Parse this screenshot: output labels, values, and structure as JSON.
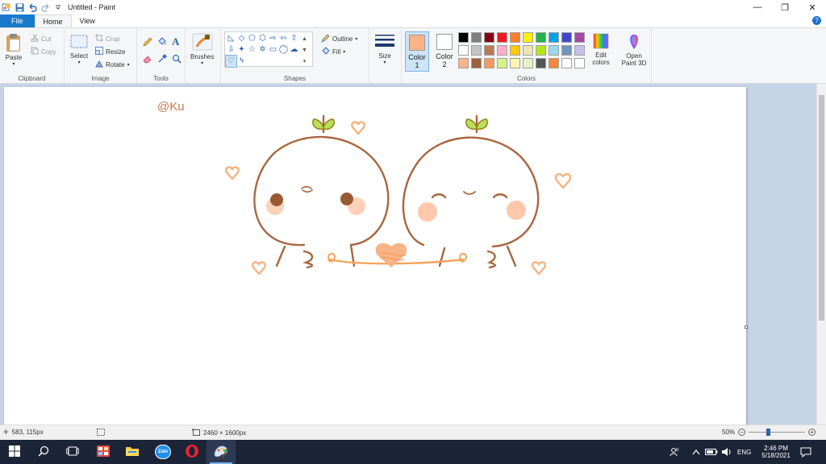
{
  "window": {
    "title": "Untitled - Paint",
    "controls": {
      "minimize": "—",
      "restore": "❐",
      "close": "✕"
    }
  },
  "ribbon_tabs": [
    {
      "label": "File"
    },
    {
      "label": "Home"
    },
    {
      "label": "View"
    }
  ],
  "help_label": "?",
  "clipboard": {
    "label": "Clipboard",
    "paste": "Paste",
    "cut": "Cut",
    "copy": "Copy"
  },
  "image": {
    "label": "Image",
    "select": "Select",
    "crop": "Crop",
    "resize": "Resize",
    "rotate": "Rotate"
  },
  "tools": {
    "label": "Tools",
    "text_tool": "A"
  },
  "brushes": {
    "label": "Brushes"
  },
  "shapes": {
    "label": "Shapes",
    "outline": "Outline",
    "fill": "Fill"
  },
  "size": {
    "label": "Size"
  },
  "colors": {
    "label": "Colors",
    "color1": {
      "label": "Color",
      "number": "1",
      "value": "#fbb387"
    },
    "color2": {
      "label": "Color",
      "number": "2",
      "value": "#ffffff"
    },
    "edit": "Edit colors",
    "open_paint3d": "Open Paint 3D",
    "palette_row1": [
      "#000000",
      "#7f7f7f",
      "#880015",
      "#ed1c24",
      "#ff7f27",
      "#fff200",
      "#22b14c",
      "#00a2e8",
      "#3f48cc",
      "#a349a4"
    ],
    "palette_row2": [
      "#ffffff",
      "#c3c3c3",
      "#b97a57",
      "#ffaec9",
      "#ffc90e",
      "#efe4b0",
      "#b5e61d",
      "#99d9ea",
      "#7092be",
      "#c8bfe7"
    ],
    "palette_row3": [
      "#fbb387",
      "#a0603c",
      "#f39a62",
      "#d6f08a",
      "#fff6b0",
      "#e8f0c6",
      "#555555",
      "#f4873d",
      "#ffffff",
      "#ffffff"
    ]
  },
  "canvas": {
    "signature": "@Ku"
  },
  "status": {
    "cursor_pos": "583, 115px",
    "image_size": "2460 × 1600px",
    "zoom": "50%",
    "zoom_level": 0.5
  },
  "taskbar": {
    "language": "ENG",
    "time": "2:46 PM",
    "date": "5/18/2021",
    "apps": [
      "windows-start",
      "search",
      "task-view",
      "photos",
      "file-explorer",
      "zalo",
      "opera",
      "paint"
    ],
    "zalo_label": "Zalo"
  }
}
